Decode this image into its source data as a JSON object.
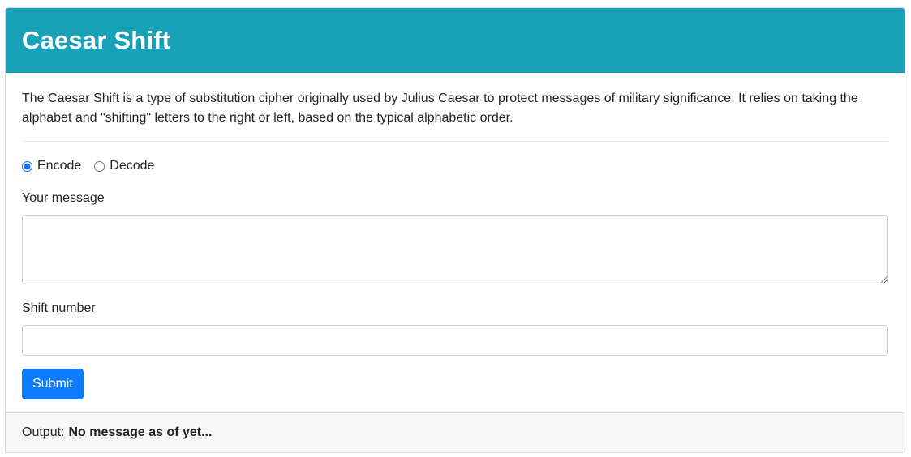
{
  "header": {
    "title": "Caesar Shift"
  },
  "intro": {
    "text": "The Caesar Shift is a type of substitution cipher originally used by Julius Caesar to protect messages of military significance. It relies on taking the alphabet and \"shifting\" letters to the right or left, based on the typical alphabetic order."
  },
  "mode": {
    "options": [
      {
        "label": "Encode",
        "selected": true
      },
      {
        "label": "Decode",
        "selected": false
      }
    ]
  },
  "form": {
    "message_label": "Your message",
    "message_value": "",
    "shift_label": "Shift number",
    "shift_value": "",
    "submit_label": "Submit"
  },
  "footer": {
    "output_label": "Output:",
    "output_value": "No message as of yet..."
  },
  "colors": {
    "header_bg": "#17a2b8",
    "primary_button": "#0d7cff",
    "footer_bg": "#f7f7f7"
  }
}
